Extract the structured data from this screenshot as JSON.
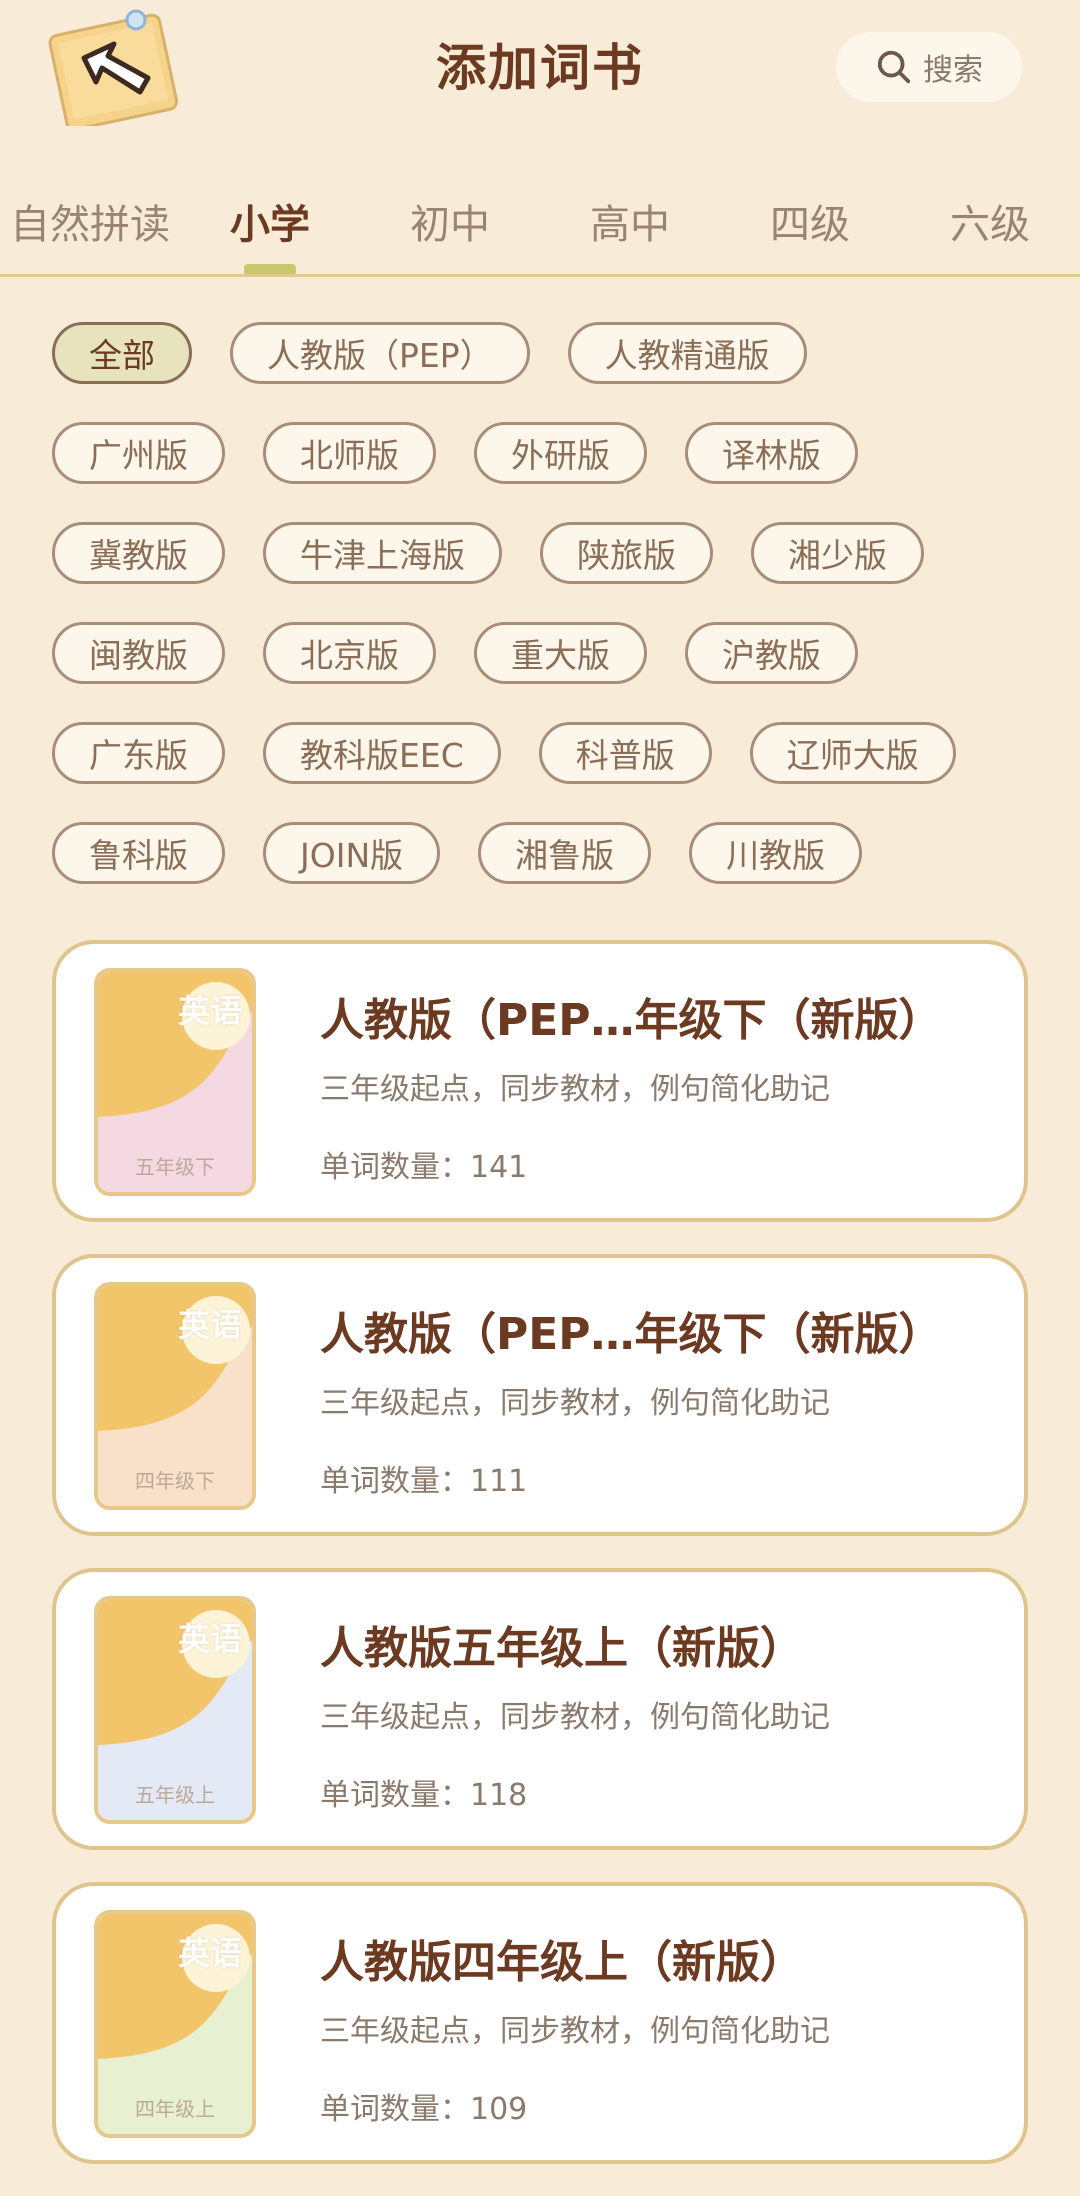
{
  "header": {
    "title": "添加词书",
    "search_label": "搜索"
  },
  "tabs": [
    {
      "label": "自然拼读",
      "active": false
    },
    {
      "label": "小学",
      "active": true
    },
    {
      "label": "初中",
      "active": false
    },
    {
      "label": "高中",
      "active": false
    },
    {
      "label": "四级",
      "active": false
    },
    {
      "label": "六级",
      "active": false
    }
  ],
  "filters": {
    "rows": [
      [
        "全部",
        "人教版（PEP）",
        "人教精通版"
      ],
      [
        "广州版",
        "北师版",
        "外研版",
        "译林版"
      ],
      [
        "冀教版",
        "牛津上海版",
        "陕旅版",
        "湘少版"
      ],
      [
        "闽教版",
        "北京版",
        "重大版",
        "沪教版"
      ],
      [
        "广东版",
        "教科版EEC",
        "科普版",
        "辽师大版"
      ],
      [
        "鲁科版",
        "JOIN版",
        "湘鲁版",
        "川教版"
      ]
    ],
    "selected": "全部"
  },
  "books": [
    {
      "cover_title": "英语",
      "cover_grade": "五年级下",
      "cover_color": "#f4d9e2",
      "title": "人教版（PEP…年级下（新版）",
      "desc": "三年级起点，同步教材，例句简化助记",
      "count": "单词数量：141"
    },
    {
      "cover_title": "英语",
      "cover_grade": "四年级下",
      "cover_color": "#f9e0c8",
      "title": "人教版（PEP…年级下（新版）",
      "desc": "三年级起点，同步教材，例句简化助记",
      "count": "单词数量：111"
    },
    {
      "cover_title": "英语",
      "cover_grade": "五年级上",
      "cover_color": "#e3e9f5",
      "title": "人教版五年级上（新版）",
      "desc": "三年级起点，同步教材，例句简化助记",
      "count": "单词数量：118"
    },
    {
      "cover_title": "英语",
      "cover_grade": "四年级上",
      "cover_color": "#e8f0d2",
      "title": "人教版四年级上（新版）",
      "desc": "三年级起点，同步教材，例句简化助记",
      "count": "单词数量：109"
    }
  ],
  "colors": {
    "background": "#f8ecd9",
    "accent": "#c7c76e",
    "title_text": "#6b3a21",
    "card_border": "#e0c48d"
  },
  "icons": {
    "back": "back-arrow-icon",
    "search": "search-icon"
  }
}
